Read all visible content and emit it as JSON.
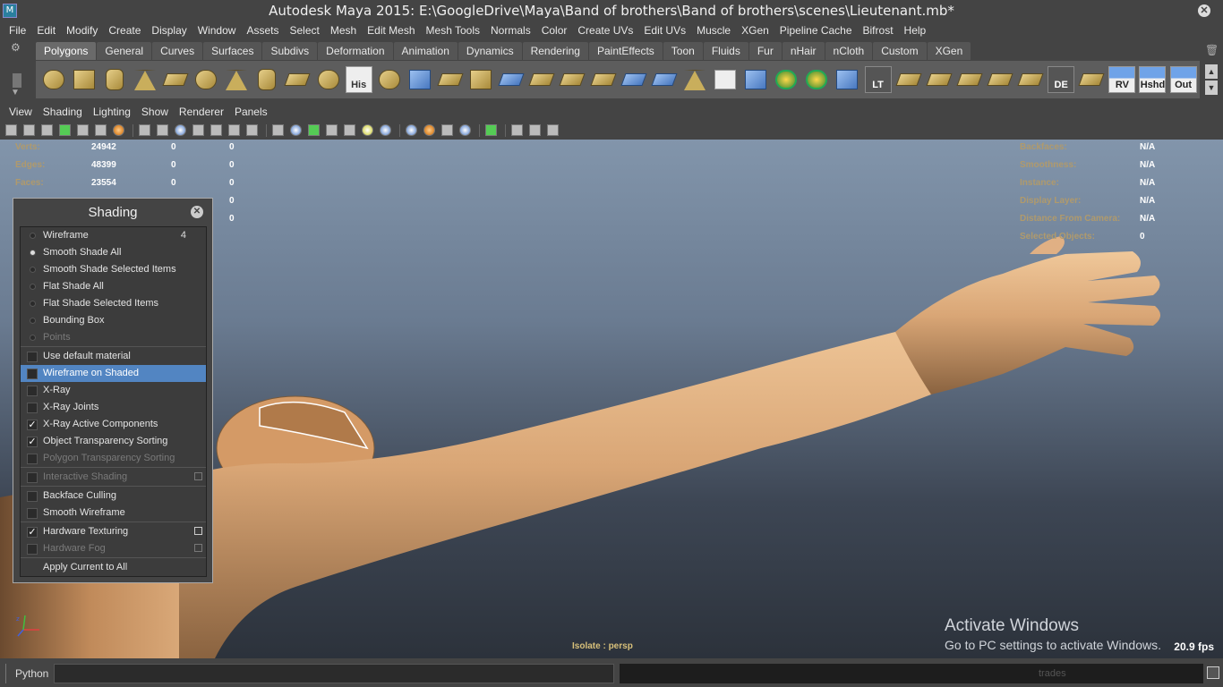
{
  "window": {
    "title": "Autodesk Maya 2015: E:\\GoogleDrive\\Maya\\Band of brothers\\Band of brothers\\scenes\\Lieutenant.mb*",
    "app_icon_glyph": "M"
  },
  "menubar": [
    "File",
    "Edit",
    "Modify",
    "Create",
    "Display",
    "Window",
    "Assets",
    "Select",
    "Mesh",
    "Edit Mesh",
    "Mesh Tools",
    "Normals",
    "Color",
    "Create UVs",
    "Edit UVs",
    "Muscle",
    "XGen",
    "Pipeline Cache",
    "Bifrost",
    "Help"
  ],
  "shelf": {
    "tabs": [
      "Polygons",
      "General",
      "Curves",
      "Surfaces",
      "Subdivs",
      "Deformation",
      "Animation",
      "Dynamics",
      "Rendering",
      "PaintEffects",
      "Toon",
      "Fluids",
      "Fur",
      "nHair",
      "nCloth",
      "Custom",
      "XGen"
    ],
    "active_tab": "Polygons",
    "icon_labels": {
      "his": "His",
      "lt": "LT",
      "de": "DE",
      "rv": "RV",
      "hshd": "Hshd",
      "out": "Out"
    }
  },
  "panel_menu": [
    "View",
    "Shading",
    "Lighting",
    "Show",
    "Renderer",
    "Panels"
  ],
  "hud": {
    "left": [
      {
        "label": "Verts:",
        "v1": "24942",
        "v2": "0",
        "v3": "0"
      },
      {
        "label": "Edges:",
        "v1": "48399",
        "v2": "0",
        "v3": "0"
      },
      {
        "label": "Faces:",
        "v1": "23554",
        "v2": "0",
        "v3": "0"
      },
      {
        "label": "",
        "v1": "",
        "v2": "",
        "v3": "0"
      },
      {
        "label": "",
        "v1": "",
        "v2": "",
        "v3": "0"
      }
    ],
    "right": [
      {
        "label": "Backfaces:",
        "value": "N/A"
      },
      {
        "label": "Smoothness:",
        "value": "N/A"
      },
      {
        "label": "Instance:",
        "value": "N/A"
      },
      {
        "label": "Display Layer:",
        "value": "N/A"
      },
      {
        "label": "Distance From Camera:",
        "value": "N/A"
      },
      {
        "label": "Selected Objects:",
        "value": "0"
      }
    ],
    "isolate": "Isolate : persp",
    "fps": "20.9 fps"
  },
  "activation": {
    "line1": "Activate Windows",
    "line2": "Go to PC settings to activate Windows."
  },
  "shading_panel": {
    "title": "Shading",
    "items": [
      {
        "type": "radio",
        "label": "Wireframe",
        "on": false,
        "hotkey": "4"
      },
      {
        "type": "radio",
        "label": "Smooth Shade All",
        "on": true
      },
      {
        "type": "radio",
        "label": "Smooth Shade Selected Items",
        "on": false
      },
      {
        "type": "radio",
        "label": "Flat Shade All",
        "on": false
      },
      {
        "type": "radio",
        "label": "Flat Shade Selected Items",
        "on": false
      },
      {
        "type": "radio",
        "label": "Bounding Box",
        "on": false
      },
      {
        "type": "radio",
        "label": "Points",
        "on": false,
        "disabled": true
      },
      {
        "type": "divider"
      },
      {
        "type": "check",
        "label": "Use default material",
        "checked": false
      },
      {
        "type": "check",
        "label": "Wireframe on Shaded",
        "checked": false,
        "selected": true
      },
      {
        "type": "check",
        "label": "X-Ray",
        "checked": false
      },
      {
        "type": "check",
        "label": "X-Ray Joints",
        "checked": false
      },
      {
        "type": "check",
        "label": "X-Ray Active Components",
        "checked": true
      },
      {
        "type": "check",
        "label": "Object Transparency Sorting",
        "checked": true
      },
      {
        "type": "check",
        "label": "Polygon Transparency Sorting",
        "checked": false,
        "disabled": true
      },
      {
        "type": "divider"
      },
      {
        "type": "check",
        "label": "Interactive Shading",
        "checked": false,
        "disabled": true,
        "option": true
      },
      {
        "type": "divider"
      },
      {
        "type": "check",
        "label": "Backface Culling",
        "checked": false
      },
      {
        "type": "check",
        "label": "Smooth Wireframe",
        "checked": false
      },
      {
        "type": "divider"
      },
      {
        "type": "check",
        "label": "Hardware Texturing",
        "checked": true,
        "option": true
      },
      {
        "type": "check",
        "label": "Hardware Fog",
        "checked": false,
        "disabled": true,
        "option": true
      },
      {
        "type": "divider"
      },
      {
        "type": "plain",
        "label": "Apply Current to All"
      }
    ]
  },
  "command_line": {
    "language": "Python",
    "value": "",
    "result_ghost_text": "trades"
  }
}
